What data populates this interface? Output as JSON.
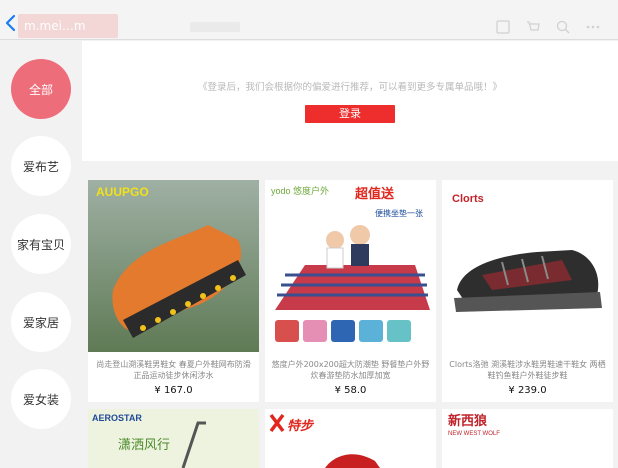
{
  "header": {
    "back_icon": "chevron-left-icon",
    "url_text": "m.mei…m",
    "icons": [
      "grid-icon",
      "cart-icon",
      "search-icon",
      "more-icon"
    ]
  },
  "sidebar": {
    "items": [
      {
        "label": "全部",
        "active": true
      },
      {
        "label": "爱布艺",
        "active": false
      },
      {
        "label": "家有宝贝",
        "active": false
      },
      {
        "label": "爱家居",
        "active": false
      },
      {
        "label": "爱女装",
        "active": false
      }
    ]
  },
  "login": {
    "message": "《登录后，我们会根据你的偏爱进行推荐，可以看到更多专属单品哦！》",
    "button": "登录"
  },
  "products": [
    {
      "brand": "AUUPGO",
      "title": "尚走登山溯溪鞋男鞋女 春夏户外鞋网布防滑正品运动徒步休闲涉水",
      "price": "¥ 167.0"
    },
    {
      "brand": "yodo 悠度户外",
      "badge": "超值送",
      "sub": "便携坐垫一张",
      "title": "悠度户外200x200超大防潮垫 野餐垫户外野炊春游垫防水加厚加宽",
      "price": "¥ 58.0"
    },
    {
      "brand": "Clorts",
      "title": "Clorts洛弛 溯溪鞋涉水鞋男鞋速干鞋女 两栖鞋钓鱼鞋户外鞋徒步鞋",
      "price": "¥ 239.0"
    },
    {
      "brand": "AEROSTAR",
      "sub": "潇洒风行",
      "title": "",
      "price": ""
    },
    {
      "brand": "特步",
      "title": "",
      "price": ""
    },
    {
      "brand": "新西狼",
      "sub": "NEW WEST WOLF",
      "title": "",
      "price": ""
    }
  ],
  "colors": {
    "accent": "#ee2d2d",
    "active_cat": "#ee6d7a"
  }
}
